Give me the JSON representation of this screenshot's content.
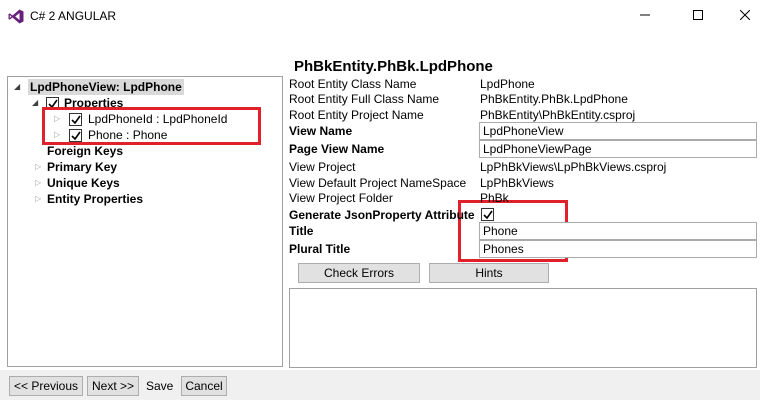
{
  "window": {
    "title": "C# 2 ANGULAR",
    "icons": {
      "app": "visual-studio-icon",
      "minimize": "minimize-icon",
      "maximize": "maximize-icon",
      "close": "close-icon"
    }
  },
  "tree": {
    "root": {
      "label": "LpdPhoneView: LpdPhone",
      "expanded": true
    },
    "properties": {
      "label": "Properties",
      "checked": true,
      "expanded": true
    },
    "items": [
      {
        "label": "LpdPhoneId : LpdPhoneId",
        "checked": true
      },
      {
        "label": "Phone : Phone",
        "checked": true
      }
    ],
    "foreign_keys": {
      "label": "Foreign Keys"
    },
    "primary_key": {
      "label": "Primary Key"
    },
    "unique_keys": {
      "label": "Unique Keys"
    },
    "entity_properties": {
      "label": "Entity Properties"
    }
  },
  "form": {
    "header": "PhBkEntity.PhBk.LpdPhone",
    "root_entity_class_name": {
      "label": "Root Entity Class Name",
      "value": "LpdPhone"
    },
    "root_entity_full_class_name": {
      "label": "Root Entity Full Class Name",
      "value": "PhBkEntity.PhBk.LpdPhone"
    },
    "root_entity_project_name": {
      "label": "Root Entity Project Name",
      "value": "PhBkEntity\\PhBkEntity.csproj"
    },
    "view_name": {
      "label": "View Name",
      "value": "LpdPhoneView"
    },
    "page_view_name": {
      "label": "Page View Name",
      "value": "LpdPhoneViewPage"
    },
    "view_project": {
      "label": "View Project",
      "value": "LpPhBkViews\\LpPhBkViews.csproj"
    },
    "view_default_project_namespace": {
      "label": "View Default Project NameSpace",
      "value": "LpPhBkViews"
    },
    "view_project_folder": {
      "label": "View Project Folder",
      "value": "PhBk"
    },
    "generate_json_property": {
      "label": "Generate JsonProperty Attribute",
      "checked": true
    },
    "title": {
      "label": "Title",
      "value": "Phone"
    },
    "plural_title": {
      "label": "Plural Title",
      "value": "Phones"
    },
    "check_errors_label": "Check Errors",
    "hints_label": "Hints",
    "output_text": ""
  },
  "footer": {
    "previous_label": "<< Previous",
    "next_label": "Next >>",
    "save_label": "Save",
    "cancel_label": "Cancel"
  },
  "colors": {
    "highlight": "#e0202a",
    "root_selection": "#d9d9d9",
    "button_bg": "#e1e1e1"
  }
}
